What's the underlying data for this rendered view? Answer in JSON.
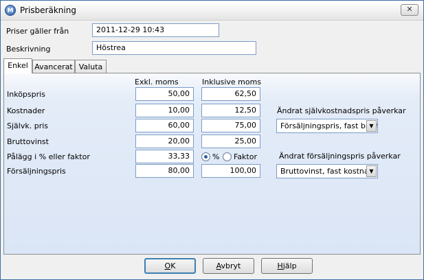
{
  "window": {
    "title": "Prisberäkning",
    "icon": "app-logo-icon",
    "close_glyph": "✕"
  },
  "header": {
    "valid_from_label": "Priser gäller från",
    "valid_from_value": "2011-12-29 10:43",
    "description_label": "Beskrivning",
    "description_value": "Höstrea"
  },
  "tabs": [
    {
      "label": "Enkel",
      "active": true
    },
    {
      "label": "Avancerat",
      "active": false
    },
    {
      "label": "Valuta",
      "active": false
    }
  ],
  "columns": {
    "excl": "Exkl. moms",
    "incl": "Inklusive moms"
  },
  "rows": [
    {
      "label": "Inköpspris",
      "excl": "50,00",
      "incl": "62,50"
    },
    {
      "label": "Kostnader",
      "excl": "10,00",
      "incl": "12,50"
    },
    {
      "label": "Självk. pris",
      "excl": "60,00",
      "incl": "75,00"
    },
    {
      "label": "Bruttovinst",
      "excl": "20,00",
      "incl": "25,00"
    },
    {
      "label": "Pålägg  i % eller faktor",
      "excl": "33,33",
      "incl": ""
    },
    {
      "label": "Försäljningspris",
      "excl": "80,00",
      "incl": "100,00"
    }
  ],
  "markup_mode": {
    "percent_label": "%",
    "factor_label": "Faktor",
    "selected": "percent"
  },
  "cost_change": {
    "label": "Ändrat självkostnadspris påverkar",
    "value": "Försäljningspris, fast bruttovinst"
  },
  "price_change": {
    "label": "Ändrat försäljningspris påverkar",
    "value": "Bruttovinst, fast kostnad"
  },
  "buttons": {
    "ok_prefix": "",
    "ok_key": "O",
    "ok_rest": "K",
    "cancel_prefix": "",
    "cancel_key": "A",
    "cancel_rest": "vbryt",
    "help_prefix": "",
    "help_key": "H",
    "help_rest": "jälp"
  },
  "colors": {
    "panel_gradient_end": "#dae5f6",
    "default_button_border": "#3c7fb1"
  }
}
